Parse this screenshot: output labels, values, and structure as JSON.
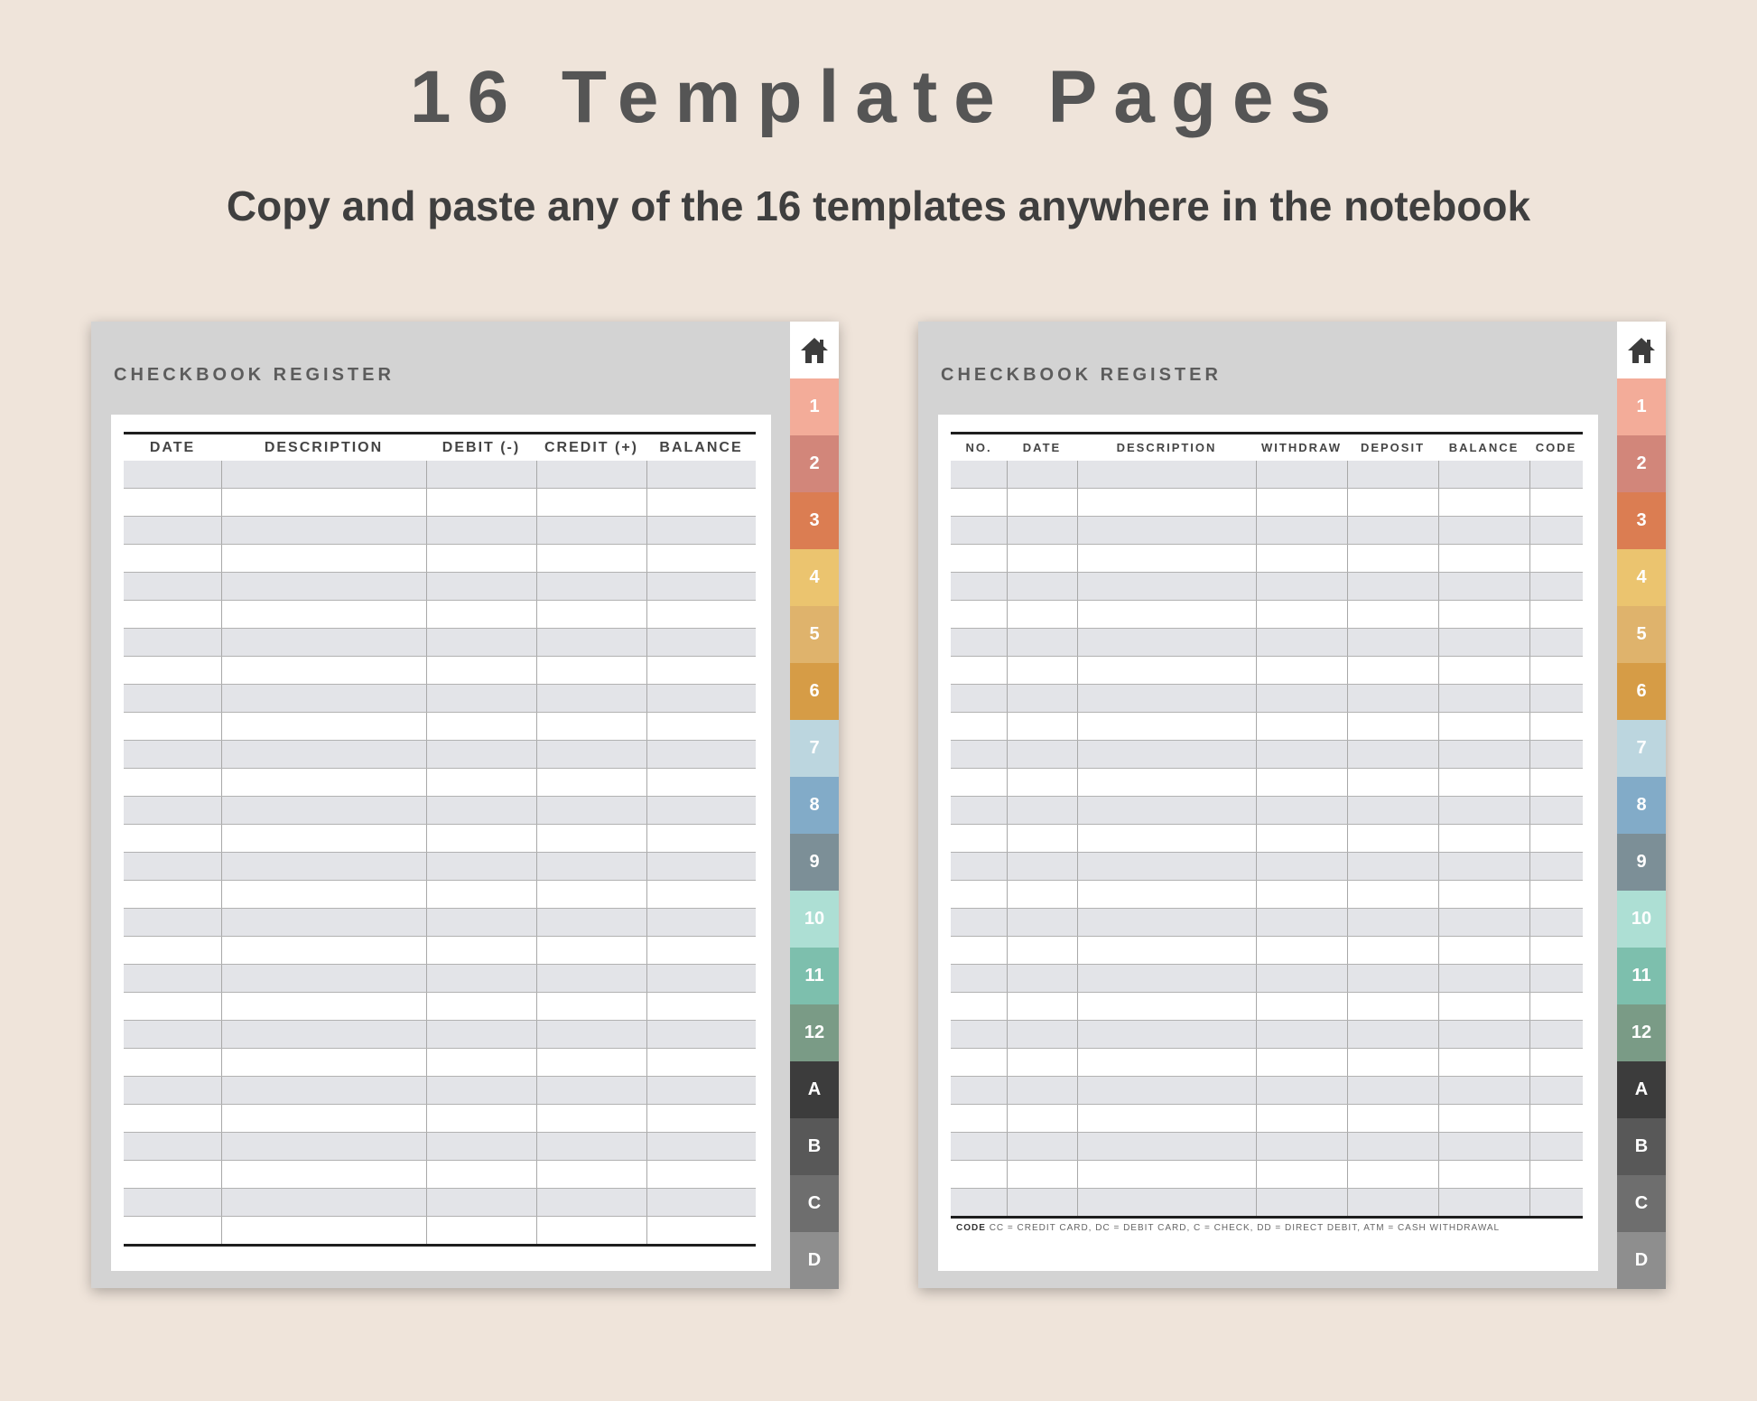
{
  "header": {
    "title": "16 Template Pages",
    "subtitle": "Copy and paste any of the 16 templates anywhere in the notebook"
  },
  "left_page": {
    "heading": "CHECKBOOK REGISTER",
    "columns": [
      "DATE",
      "DESCRIPTION",
      "DEBIT (-)",
      "CREDIT (+)",
      "BALANCE"
    ]
  },
  "right_page": {
    "heading": "CHECKBOOK REGISTER",
    "columns": [
      "NO.",
      "DATE",
      "DESCRIPTION",
      "WITHDRAW",
      "DEPOSIT",
      "BALANCE",
      "CODE"
    ],
    "code_label": "CODE",
    "code_legend": "CC = CREDIT CARD, DC = DEBIT CARD, C = CHECK, DD = DIRECT DEBIT, ATM = CASH WITHDRAWAL"
  },
  "tabs": {
    "home_icon": "home-icon",
    "items": [
      {
        "label": "1",
        "color": "#f3ac99"
      },
      {
        "label": "2",
        "color": "#d2867a"
      },
      {
        "label": "3",
        "color": "#db7d52"
      },
      {
        "label": "4",
        "color": "#ebc46f"
      },
      {
        "label": "5",
        "color": "#dfb36c"
      },
      {
        "label": "6",
        "color": "#d69c46"
      },
      {
        "label": "7",
        "color": "#bcd6df"
      },
      {
        "label": "8",
        "color": "#82abc8"
      },
      {
        "label": "9",
        "color": "#7c8f97"
      },
      {
        "label": "10",
        "color": "#addfd4"
      },
      {
        "label": "11",
        "color": "#7dbfad"
      },
      {
        "label": "12",
        "color": "#7a9b86"
      },
      {
        "label": "A",
        "color": "#3c3c3c"
      },
      {
        "label": "B",
        "color": "#585858"
      },
      {
        "label": "C",
        "color": "#6e6e6e"
      },
      {
        "label": "D",
        "color": "#8e8e8e"
      }
    ]
  }
}
